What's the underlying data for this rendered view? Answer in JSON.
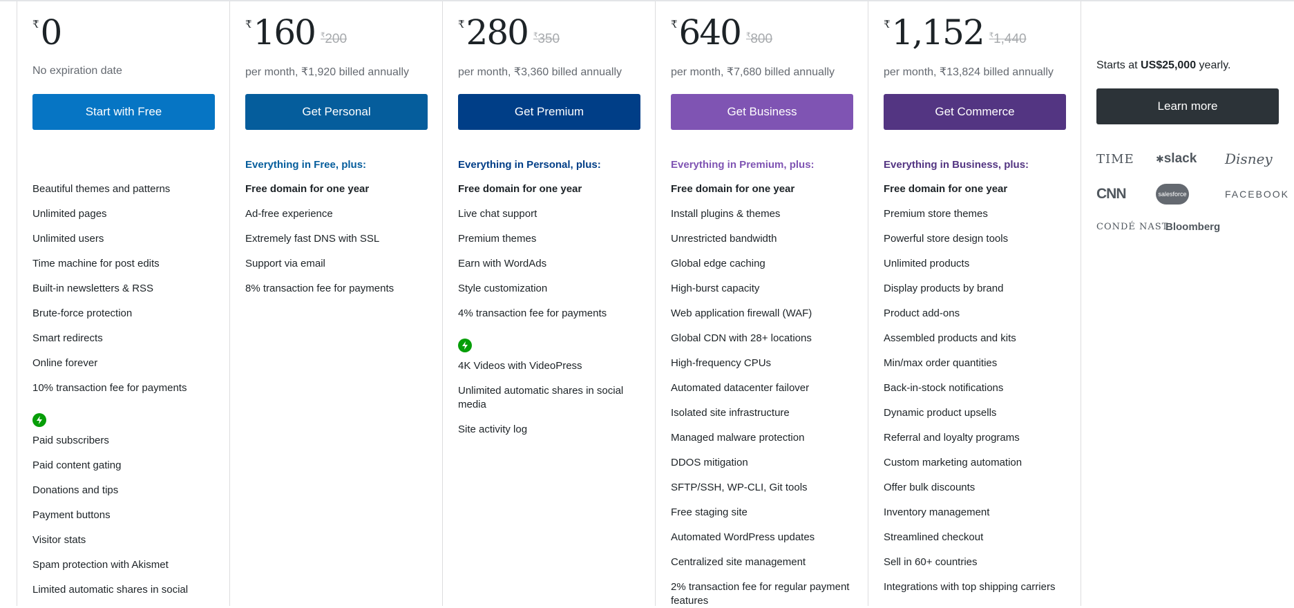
{
  "colors": {
    "free": "#0675c4",
    "personal": "#055d9c",
    "premium": "#003e87",
    "business": "#7f54b3",
    "commerce": "#533582",
    "enterprise": "#2c3338",
    "personal_heading": "#055d9c",
    "premium_heading": "#003e87",
    "business_heading": "#7f54b3",
    "commerce_heading": "#533582"
  },
  "plans": [
    {
      "currency": "₹",
      "amount": "0",
      "original": "",
      "period": "No expiration date",
      "cta": "Start with Free",
      "heading": "",
      "features": [
        "Beautiful themes and patterns",
        "Unlimited pages",
        "Unlimited users",
        "Time machine for post edits",
        "Built-in newsletters & RSS",
        "Brute-force protection",
        "Smart redirects",
        "Online forever",
        "10% transaction fee for payments"
      ],
      "extras": [
        "Paid subscribers",
        "Paid content gating",
        "Donations and tips",
        "Payment buttons",
        "Visitor stats",
        "Spam protection with Akismet",
        "Limited automatic shares in social"
      ]
    },
    {
      "currency": "₹",
      "amount": "160",
      "original_currency": "₹",
      "original": "200",
      "period": "per month, ₹1,920 billed annually",
      "cta": "Get Personal",
      "heading": "Everything in Free, plus:",
      "first_feature": "Free domain for one year",
      "features": [
        "Ad-free experience",
        "Extremely fast DNS with SSL",
        "Support via email",
        "8% transaction fee for payments"
      ]
    },
    {
      "currency": "₹",
      "amount": "280",
      "original_currency": "₹",
      "original": "350",
      "period": "per month, ₹3,360 billed annually",
      "cta": "Get Premium",
      "heading": "Everything in Personal, plus:",
      "first_feature": "Free domain for one year",
      "features": [
        "Live chat support",
        "Premium themes",
        "Earn with WordAds",
        "Style customization",
        "4% transaction fee for payments"
      ],
      "extras": [
        "4K Videos with VideoPress",
        "Unlimited automatic shares in social media",
        "Site activity log"
      ]
    },
    {
      "currency": "₹",
      "amount": "640",
      "original_currency": "₹",
      "original": "800",
      "period": "per month, ₹7,680 billed annually",
      "cta": "Get Business",
      "heading": "Everything in Premium, plus:",
      "first_feature": "Free domain for one year",
      "features": [
        "Install plugins & themes",
        "Unrestricted bandwidth",
        "Global edge caching",
        "High-burst capacity",
        "Web application firewall (WAF)",
        "Global CDN with 28+ locations",
        "High-frequency CPUs",
        "Automated datacenter failover",
        "Isolated site infrastructure",
        "Managed malware protection",
        "DDOS mitigation",
        "SFTP/SSH, WP-CLI, Git tools",
        "Free staging site",
        "Automated WordPress updates",
        "Centralized site management",
        "2% transaction fee for regular payment features"
      ]
    },
    {
      "currency": "₹",
      "amount": "1,152",
      "original_currency": "₹",
      "original": "1,440",
      "period": "per month, ₹13,824 billed annually",
      "cta": "Get Commerce",
      "heading": "Everything in Business, plus:",
      "first_feature": "Free domain for one year",
      "features": [
        "Premium store themes",
        "Powerful store design tools",
        "Unlimited products",
        "Display products by brand",
        "Product add-ons",
        "Assembled products and kits",
        "Min/max order quantities",
        "Back-in-stock notifications",
        "Dynamic product upsells",
        "Referral and loyalty programs",
        "Custom marketing automation",
        "Offer bulk discounts",
        "Inventory management",
        "Streamlined checkout",
        "Sell in 60+ countries",
        "Integrations with top shipping carriers"
      ]
    }
  ],
  "enterprise": {
    "text_prefix": "Starts at ",
    "text_price": "US$25,000",
    "text_suffix": " yearly.",
    "cta": "Learn more",
    "logos": [
      "TIME",
      "slack",
      "Disney",
      "CNN",
      "salesforce",
      "FACEBOOK",
      "CONDÉ NAST",
      "Bloomberg"
    ]
  }
}
